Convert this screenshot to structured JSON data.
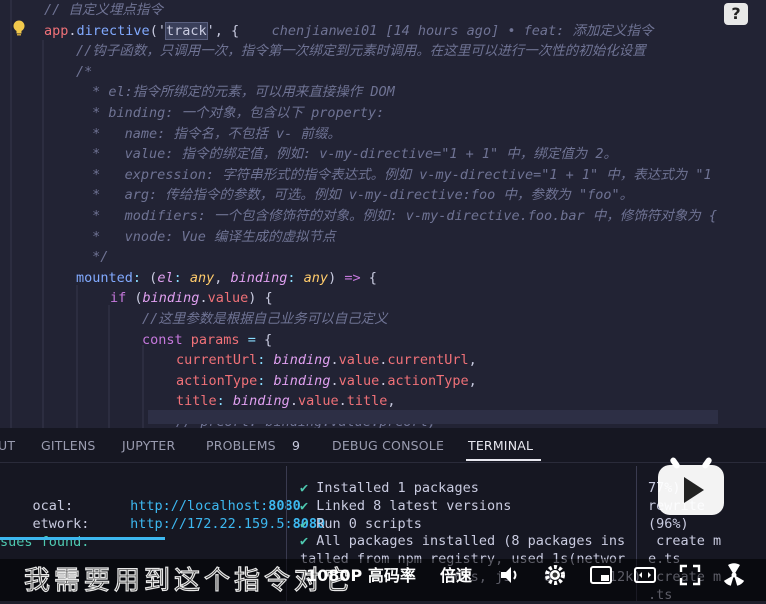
{
  "editor": {
    "lines": [
      [
        [
          "cm",
          "// 自定义埋点指令"
        ]
      ],
      [
        [
          "pr",
          "app"
        ],
        [
          "pl",
          "."
        ],
        [
          "fn",
          "directive"
        ],
        [
          "pl",
          "('"
        ],
        [
          "hl",
          "track"
        ],
        [
          "pl",
          "', {"
        ],
        [
          "lens",
          "    chenjianwei01 [14 hours ago] • feat: 添加定义指令"
        ]
      ],
      [
        [
          "cm",
          "//钩子函数，只调用一次，指令第一次绑定到元素时调用。在这里可以进行一次性的初始化设置"
        ]
      ],
      [
        [
          "cm",
          "/*"
        ]
      ],
      [
        [
          "cm",
          " * el:指令所绑定的元素，可以用来直接操作 DOM"
        ]
      ],
      [
        [
          "cm",
          " * binding: 一个对象，包含以下 property:"
        ]
      ],
      [
        [
          "cm",
          " *   name: 指令名，不包括 v- 前缀。"
        ]
      ],
      [
        [
          "cm",
          " *   value: 指令的绑定值，例如: v-my-directive=\"1 + 1\" 中，绑定值为 2。"
        ]
      ],
      [
        [
          "cm",
          " *   expression: 字符串形式的指令表达式。例如 v-my-directive=\"1 + 1\" 中，表达式为 \"1"
        ]
      ],
      [
        [
          "cm",
          " *   arg: 传给指令的参数，可选。例如 v-my-directive:foo 中，参数为 \"foo\"。"
        ]
      ],
      [
        [
          "cm",
          " *   modifiers: 一个包含修饰符的对象。例如: v-my-directive.foo.bar 中，修饰符对象为 {"
        ]
      ],
      [
        [
          "cm",
          " *   vnode: Vue 编译生成的虚拟节点"
        ]
      ],
      [
        [
          "cm",
          " */"
        ]
      ],
      [
        [
          "fn",
          "mounted"
        ],
        [
          "op",
          ": "
        ],
        [
          "pl",
          "("
        ],
        [
          "pa",
          "el"
        ],
        [
          "op",
          ": "
        ],
        [
          "ty",
          "any"
        ],
        [
          "pl",
          ", "
        ],
        [
          "pa",
          "binding"
        ],
        [
          "op",
          ": "
        ],
        [
          "ty",
          "any"
        ],
        [
          "pl",
          ") "
        ],
        [
          "kw",
          "=>"
        ],
        [
          "pl",
          " {"
        ]
      ],
      [
        [
          "kw",
          "if"
        ],
        [
          "pl",
          " ("
        ],
        [
          "pa",
          "binding"
        ],
        [
          "pl",
          "."
        ],
        [
          "pr",
          "value"
        ],
        [
          "pl",
          ") {"
        ]
      ],
      [
        [
          "cm",
          "//这里参数是根据自己业务可以自己定义"
        ]
      ],
      [
        [
          "kw",
          "const"
        ],
        [
          "pl",
          " "
        ],
        [
          "pr",
          "params"
        ],
        [
          "pl",
          " "
        ],
        [
          "op",
          "="
        ],
        [
          "pl",
          " {"
        ]
      ],
      [
        [
          "pr",
          "currentUrl"
        ],
        [
          "op",
          ": "
        ],
        [
          "pa",
          "binding"
        ],
        [
          "pl",
          "."
        ],
        [
          "pr",
          "value"
        ],
        [
          "pl",
          "."
        ],
        [
          "pr",
          "currentUrl"
        ],
        [
          "pl",
          ","
        ]
      ],
      [
        [
          "pr",
          "actionType"
        ],
        [
          "op",
          ": "
        ],
        [
          "pa",
          "binding"
        ],
        [
          "pl",
          "."
        ],
        [
          "pr",
          "value"
        ],
        [
          "pl",
          "."
        ],
        [
          "pr",
          "actionType"
        ],
        [
          "pl",
          ","
        ]
      ],
      [
        [
          "pr",
          "title"
        ],
        [
          "op",
          ": "
        ],
        [
          "pa",
          "binding"
        ],
        [
          "pl",
          "."
        ],
        [
          "pr",
          "value"
        ],
        [
          "pl",
          "."
        ],
        [
          "pr",
          "title"
        ],
        [
          "pl",
          ","
        ]
      ],
      [
        [
          "cm",
          "// preUrl: binding.value.preUrl,"
        ]
      ]
    ],
    "help_icon": "?"
  },
  "panel": {
    "tabs": [
      "UT",
      "GITLENS",
      "JUPYTER",
      "PROBLEMS",
      "9",
      "DEBUG CONSOLE",
      "TERMINAL"
    ],
    "active_tab": "TERMINAL",
    "left": {
      "local_label": "ocal:",
      "local_url_host": "http://localhost:",
      "local_port": "8080",
      "network_label": "etwork:",
      "network_url_host": "http://172.22.159.5:",
      "network_port": "8080",
      "issues": "sues found."
    },
    "middle": [
      "✔ Installed 1 packages",
      "✔ Linked 8 latest versions",
      "✔ Run 0 scripts",
      "✔ All packages installed (8 packages ins",
      "talled from npm registry, used 1s(networ",
      "k                 46ms, js    8       12k)"
    ],
    "right": [
      "77%)",
      "rewrite",
      "(96%)",
      " create m",
      "e.ts",
      " create m",
      ".ts"
    ]
  },
  "player": {
    "subtitle": "我需要用到这个指令对它",
    "quality": "1080P 高码率",
    "speed": "倍速"
  },
  "colors": {
    "editor_bg": "#222334",
    "panel_bg": "#161722",
    "accent_blue": "#3db8f0"
  }
}
